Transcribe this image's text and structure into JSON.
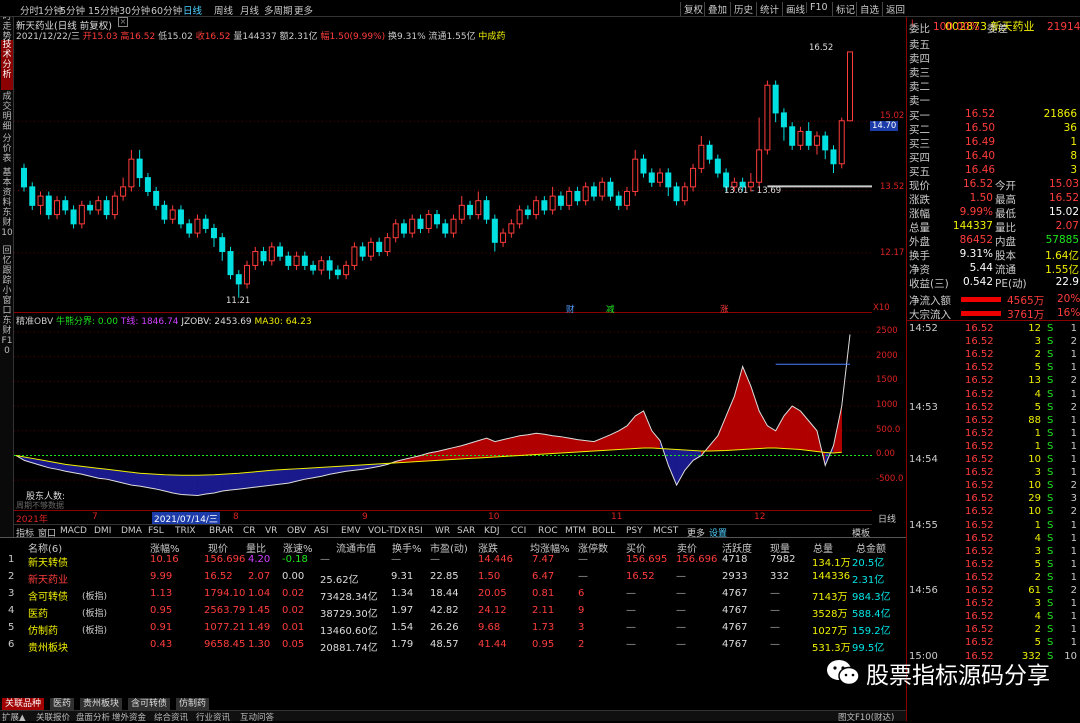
{
  "top": {
    "periods": [
      "分时",
      "1分钟",
      "5分钟",
      "15分钟",
      "30分钟",
      "60分钟",
      "日线",
      "周线",
      "月线",
      "多周期",
      "更多"
    ],
    "selected": "日线",
    "tools": [
      "复权",
      "叠加",
      "历史",
      "统计",
      "画线",
      "F10",
      "标记",
      "自选",
      "返回"
    ]
  },
  "left_sidebar": [
    "分时走势",
    "技术分析",
    "成交明细",
    "分价表",
    "基本资料",
    "东财10",
    "回忆跟踪",
    "小窗口",
    "东财F10"
  ],
  "main_chart": {
    "header_title": "新天药业(日线 前复权)",
    "info_date": "2021/12/22/三",
    "open": "开15.03",
    "high": "高16.52",
    "low": "低15.02",
    "close": "收16.52",
    "volume": "量144337",
    "amount": "额2.31亿",
    "change": "幅1.50(9.99%)",
    "turnover": "换9.31%",
    "float_value": "流通1.55亿",
    "concept": "中成药",
    "price_axis": [
      "15.02",
      "14.70",
      "13.52",
      "12.17"
    ],
    "label_max": "16.52",
    "label_min": "11.21",
    "label_range": "13.61 - 13.69",
    "markers": [
      "财",
      "减",
      "涨"
    ],
    "zoom": "X10"
  },
  "obv_chart": {
    "title": "精准OBV",
    "label1": "牛熊分界: 0.00",
    "label2": "T线: 1846.74",
    "label3": "JZOBV: 2453.69",
    "label4": "MA30: 64.23",
    "axis": [
      "2500",
      "2000",
      "1500",
      "1000",
      "500.0",
      "0.00",
      "-500.0"
    ],
    "footer_label": "股东人数:",
    "footer_sub": "周期不够数据",
    "date_axis": [
      "2021年",
      "7",
      "2021/07/14/三",
      "8",
      "9",
      "10",
      "11",
      "12"
    ],
    "period": "日线"
  },
  "indicator_tabs": [
    "指标",
    "窗口",
    "MACD",
    "DMI",
    "DMA",
    "FSL",
    "TRIX",
    "BRAR",
    "CR",
    "VR",
    "OBV",
    "ASI",
    "EMV",
    "VOL-TDX",
    "RSI",
    "WR",
    "SAR",
    "KDJ",
    "CCI",
    "ROC",
    "MTM",
    "BOLL",
    "PSY",
    "MCST",
    "更多",
    "设置"
  ],
  "table": {
    "headers": [
      "名称(6)",
      "涨幅%",
      "现价",
      "量比",
      "涨速%",
      "流通市值",
      "换手%",
      "市盈(动)",
      "涨跌",
      "均涨幅%",
      "涨停数",
      "买价",
      "卖价",
      "活跃度",
      "现量",
      "总量",
      "总金额"
    ],
    "rows": [
      {
        "no": "1",
        "name": "新天转债",
        "tag": "",
        "c": [
          "10.16",
          "156.696",
          "4.20",
          "-0.18",
          "—",
          "—",
          "—",
          "14.446",
          "7.47",
          "—",
          "156.695",
          "156.696",
          "4718",
          "7982",
          "134.1万",
          "20.5亿"
        ]
      },
      {
        "no": "2",
        "name": "新天药业",
        "tag": "",
        "c": [
          "9.99",
          "16.52",
          "2.07",
          "0.00",
          "25.62亿",
          "9.31",
          "22.85",
          "1.50",
          "6.47",
          "—",
          "16.52",
          "—",
          "2933",
          "332",
          "144336",
          "2.31亿"
        ]
      },
      {
        "no": "3",
        "name": "含可转债",
        "tag": "(板指)",
        "c": [
          "1.13",
          "1794.10",
          "1.04",
          "0.02",
          "73428.34亿",
          "1.34",
          "18.44",
          "20.05",
          "0.81",
          "6",
          "—",
          "—",
          "4767",
          "—",
          "7143万",
          "984.3亿"
        ]
      },
      {
        "no": "4",
        "name": "医药",
        "tag": "(板指)",
        "c": [
          "0.95",
          "2563.79",
          "1.45",
          "0.02",
          "38729.30亿",
          "1.97",
          "42.82",
          "24.12",
          "2.11",
          "9",
          "—",
          "—",
          "4767",
          "—",
          "3528万",
          "588.4亿"
        ]
      },
      {
        "no": "5",
        "name": "仿制药",
        "tag": "(板指)",
        "c": [
          "0.91",
          "1077.21",
          "1.49",
          "0.01",
          "13460.60亿",
          "1.54",
          "26.26",
          "9.68",
          "1.73",
          "3",
          "—",
          "—",
          "4767",
          "—",
          "1027万",
          "159.2亿"
        ]
      },
      {
        "no": "6",
        "name": "贵州板块",
        "tag": "",
        "c": [
          "0.43",
          "9658.45",
          "1.30",
          "0.05",
          "20881.74亿",
          "1.79",
          "48.57",
          "41.44",
          "0.95",
          "2",
          "—",
          "—",
          "4767",
          "—",
          "531.3万",
          "99.5亿"
        ]
      }
    ]
  },
  "bottom_tabs": [
    "关联品种",
    "医药",
    "贵州板块",
    "含可转债",
    "仿制药"
  ],
  "status_bar": [
    "扩展▲",
    "关联报价",
    "盘面分析",
    "增外资金",
    "综合资讯",
    "行业资讯",
    "互动问答",
    "图文F10(财达)"
  ],
  "right_panel": {
    "code_line": "002873 新天药业",
    "wb_label": "委比",
    "wb": "100.00%",
    "wc_label": "委差",
    "wc": "21914",
    "asks": [
      "卖五",
      "卖四",
      "卖三",
      "卖二",
      "卖一"
    ],
    "bids": [
      [
        "买一",
        "16.52",
        "21866"
      ],
      [
        "买二",
        "16.50",
        "36"
      ],
      [
        "买三",
        "16.49",
        "1"
      ],
      [
        "买四",
        "16.40",
        "8"
      ],
      [
        "买五",
        "16.46",
        "3"
      ]
    ],
    "stats": [
      [
        "现价",
        "16.52",
        "今开",
        "15.03"
      ],
      [
        "涨跌",
        "1.50",
        "最高",
        "16.52"
      ],
      [
        "涨幅",
        "9.99%",
        "最低",
        "15.02"
      ],
      [
        "总量",
        "144337",
        "量比",
        "2.07"
      ],
      [
        "外盘",
        "86452",
        "内盘",
        "57885"
      ],
      [
        "换手",
        "9.31%",
        "股本",
        "1.64亿"
      ],
      [
        "净资",
        "5.44",
        "流通",
        "1.55亿"
      ],
      [
        "收益(三)",
        "0.542",
        "PE(动)",
        "22.9"
      ]
    ],
    "flow": [
      [
        "净流入额",
        "4565万",
        "20%"
      ],
      [
        "大宗流入",
        "3761万",
        "16%"
      ]
    ],
    "ticks": [
      [
        "14:52",
        "16.52",
        "12",
        "S",
        "1"
      ],
      [
        "",
        "16.52",
        "3",
        "S",
        "2"
      ],
      [
        "",
        "16.52",
        "2",
        "S",
        "1"
      ],
      [
        "",
        "16.52",
        "5",
        "S",
        "1"
      ],
      [
        "",
        "16.52",
        "13",
        "S",
        "2"
      ],
      [
        "",
        "16.52",
        "4",
        "S",
        "1"
      ],
      [
        "14:53",
        "16.52",
        "5",
        "S",
        "2"
      ],
      [
        "",
        "16.52",
        "88",
        "S",
        "1"
      ],
      [
        "",
        "16.52",
        "1",
        "S",
        "1"
      ],
      [
        "",
        "16.52",
        "1",
        "S",
        "1"
      ],
      [
        "14:54",
        "16.52",
        "10",
        "S",
        "1"
      ],
      [
        "",
        "16.52",
        "3",
        "S",
        "1"
      ],
      [
        "",
        "16.52",
        "10",
        "S",
        "2"
      ],
      [
        "",
        "16.52",
        "29",
        "S",
        "3"
      ],
      [
        "",
        "16.52",
        "10",
        "S",
        "2"
      ],
      [
        "14:55",
        "16.52",
        "1",
        "S",
        "1"
      ],
      [
        "",
        "16.52",
        "4",
        "S",
        "1"
      ],
      [
        "",
        "16.52",
        "3",
        "S",
        "1"
      ],
      [
        "",
        "16.52",
        "5",
        "S",
        "1"
      ],
      [
        "",
        "16.52",
        "2",
        "S",
        "1"
      ],
      [
        "14:56",
        "16.52",
        "61",
        "S",
        "2"
      ],
      [
        "",
        "16.52",
        "3",
        "S",
        "1"
      ],
      [
        "",
        "16.52",
        "4",
        "S",
        "1"
      ],
      [
        "",
        "16.52",
        "2",
        "S",
        "1"
      ],
      [
        "",
        "16.52",
        "5",
        "S",
        "1"
      ],
      [
        "15:00",
        "16.52",
        "332",
        "S",
        "10"
      ]
    ]
  },
  "watermark": "股票指标源码分享",
  "candles": [
    [
      14.0,
      13.6,
      14.1,
      13.5
    ],
    [
      13.6,
      13.2,
      13.7,
      13.1
    ],
    [
      13.2,
      13.4,
      13.5,
      13.0
    ],
    [
      13.4,
      13.0,
      13.5,
      12.9
    ],
    [
      13.0,
      13.3,
      13.4,
      12.9
    ],
    [
      13.3,
      13.1,
      13.4,
      13.0
    ],
    [
      13.1,
      12.8,
      13.2,
      12.7
    ],
    [
      12.8,
      13.2,
      13.3,
      12.7
    ],
    [
      13.2,
      13.1,
      13.3,
      13.0
    ],
    [
      13.1,
      13.3,
      13.4,
      13.0
    ],
    [
      13.3,
      13.0,
      13.4,
      12.9
    ],
    [
      13.0,
      13.4,
      13.5,
      12.9
    ],
    [
      13.4,
      13.6,
      13.8,
      13.3
    ],
    [
      13.6,
      14.2,
      14.4,
      13.5
    ],
    [
      14.2,
      13.8,
      14.4,
      13.6
    ],
    [
      13.8,
      13.5,
      13.9,
      13.4
    ],
    [
      13.5,
      13.2,
      13.6,
      13.1
    ],
    [
      13.2,
      12.9,
      13.3,
      12.8
    ],
    [
      12.9,
      13.1,
      13.2,
      12.8
    ],
    [
      13.1,
      12.8,
      13.2,
      12.7
    ],
    [
      12.8,
      12.6,
      12.9,
      12.5
    ],
    [
      12.6,
      12.9,
      13.0,
      12.5
    ],
    [
      12.9,
      12.7,
      13.0,
      12.6
    ],
    [
      12.7,
      12.5,
      12.8,
      12.3
    ],
    [
      12.5,
      12.2,
      12.6,
      12.0
    ],
    [
      12.2,
      11.7,
      12.3,
      11.6
    ],
    [
      11.7,
      11.5,
      11.8,
      11.2
    ],
    [
      11.5,
      11.9,
      12.0,
      11.4
    ],
    [
      11.9,
      12.2,
      12.3,
      11.8
    ],
    [
      12.2,
      12.0,
      12.3,
      11.9
    ],
    [
      12.0,
      12.3,
      12.4,
      11.9
    ],
    [
      12.3,
      12.1,
      12.4,
      12.0
    ],
    [
      12.1,
      11.9,
      12.2,
      11.8
    ],
    [
      11.9,
      12.1,
      12.2,
      11.8
    ],
    [
      12.1,
      11.9,
      12.2,
      11.8
    ],
    [
      11.9,
      11.8,
      12.0,
      11.7
    ],
    [
      11.8,
      12.0,
      12.1,
      11.7
    ],
    [
      12.0,
      11.8,
      12.1,
      11.6
    ],
    [
      11.8,
      11.7,
      11.9,
      11.6
    ],
    [
      11.7,
      11.9,
      12.0,
      11.6
    ],
    [
      11.9,
      12.3,
      12.4,
      11.8
    ],
    [
      12.3,
      12.1,
      12.4,
      12.0
    ],
    [
      12.1,
      12.4,
      12.5,
      12.0
    ],
    [
      12.4,
      12.2,
      12.5,
      12.1
    ],
    [
      12.2,
      12.5,
      12.6,
      12.1
    ],
    [
      12.5,
      12.8,
      12.9,
      12.4
    ],
    [
      12.8,
      12.6,
      12.9,
      12.5
    ],
    [
      12.6,
      12.9,
      13.0,
      12.5
    ],
    [
      12.9,
      12.7,
      13.0,
      12.6
    ],
    [
      12.7,
      13.0,
      13.1,
      12.6
    ],
    [
      13.0,
      12.8,
      13.1,
      12.7
    ],
    [
      12.8,
      12.6,
      12.9,
      12.5
    ],
    [
      12.6,
      12.9,
      13.0,
      12.5
    ],
    [
      12.9,
      13.2,
      13.4,
      12.8
    ],
    [
      13.2,
      13.0,
      13.3,
      12.9
    ],
    [
      13.0,
      13.3,
      13.5,
      12.9
    ],
    [
      13.3,
      12.9,
      13.4,
      12.8
    ],
    [
      12.9,
      12.4,
      13.0,
      12.2
    ],
    [
      12.4,
      12.6,
      12.7,
      12.3
    ],
    [
      12.6,
      12.8,
      12.9,
      12.5
    ],
    [
      12.8,
      13.1,
      13.2,
      12.7
    ],
    [
      13.1,
      13.0,
      13.2,
      12.9
    ],
    [
      13.0,
      13.3,
      13.4,
      12.9
    ],
    [
      13.3,
      13.1,
      13.4,
      13.0
    ],
    [
      13.1,
      13.4,
      13.6,
      13.0
    ],
    [
      13.4,
      13.2,
      13.5,
      13.1
    ],
    [
      13.2,
      13.5,
      13.6,
      13.1
    ],
    [
      13.5,
      13.3,
      13.6,
      13.2
    ],
    [
      13.3,
      13.6,
      13.7,
      13.2
    ],
    [
      13.6,
      13.4,
      13.7,
      13.3
    ],
    [
      13.4,
      13.7,
      13.8,
      13.3
    ],
    [
      13.7,
      13.4,
      13.8,
      13.3
    ],
    [
      13.4,
      13.2,
      13.5,
      13.1
    ],
    [
      13.2,
      13.5,
      13.6,
      13.1
    ],
    [
      13.5,
      14.2,
      14.4,
      13.4
    ],
    [
      14.2,
      13.9,
      14.3,
      13.8
    ],
    [
      13.9,
      13.7,
      14.0,
      13.6
    ],
    [
      13.7,
      13.9,
      14.0,
      13.6
    ],
    [
      13.9,
      13.6,
      14.0,
      13.4
    ],
    [
      13.6,
      13.3,
      13.7,
      13.2
    ],
    [
      13.3,
      13.6,
      13.7,
      13.2
    ],
    [
      13.6,
      14.0,
      14.1,
      13.5
    ],
    [
      14.0,
      14.5,
      14.7,
      13.9
    ],
    [
      14.5,
      14.2,
      14.6,
      14.1
    ],
    [
      14.2,
      13.9,
      14.3,
      13.8
    ],
    [
      13.9,
      13.6,
      14.0,
      13.5
    ],
    [
      13.6,
      13.7,
      13.8,
      13.5
    ],
    [
      13.7,
      13.6,
      13.8,
      13.5
    ],
    [
      13.6,
      13.7,
      13.9,
      13.5
    ],
    [
      13.7,
      14.4,
      15.1,
      13.6
    ],
    [
      14.4,
      15.8,
      15.9,
      14.3
    ],
    [
      15.8,
      15.2,
      15.9,
      15.0
    ],
    [
      15.2,
      14.9,
      15.3,
      14.6
    ],
    [
      14.9,
      14.5,
      15.0,
      14.4
    ],
    [
      14.5,
      14.8,
      14.9,
      14.4
    ],
    [
      14.8,
      14.5,
      15.0,
      14.4
    ],
    [
      14.5,
      14.7,
      14.8,
      14.3
    ],
    [
      14.7,
      14.4,
      14.8,
      14.2
    ],
    [
      14.4,
      14.1,
      14.5,
      13.9
    ],
    [
      14.1,
      15.03,
      15.1,
      14.0
    ],
    [
      15.03,
      16.52,
      16.52,
      15.02
    ]
  ],
  "obv": [
    0,
    -100,
    -150,
    -200,
    -250,
    -280,
    -320,
    -350,
    -380,
    -420,
    -460,
    -480,
    -520,
    -560,
    -600,
    -620,
    -650,
    -680,
    -720,
    -760,
    -790,
    -800,
    -810,
    -780,
    -760,
    -720,
    -700,
    -680,
    -660,
    -640,
    -620,
    -600,
    -580,
    -560,
    -520,
    -480,
    -450,
    -420,
    -380,
    -350,
    -320,
    -300,
    -280,
    -250,
    -220,
    -180,
    -120,
    -80,
    -40,
    0,
    50,
    80,
    120,
    160,
    200,
    250,
    300,
    350,
    280,
    320,
    360,
    400,
    420,
    450,
    430,
    400,
    380,
    350,
    320,
    300,
    280,
    350,
    420,
    500,
    600,
    800,
    900,
    500,
    300,
    -200,
    -600,
    -300,
    -100,
    0,
    200,
    400,
    800,
    1200,
    1800,
    1400,
    900,
    600,
    500,
    800,
    1000,
    900,
    700,
    500,
    -200,
    200,
    1000,
    2450
  ],
  "ma": [
    0,
    -30,
    -60,
    -90,
    -120,
    -150,
    -180,
    -200,
    -220,
    -240,
    -260,
    -280,
    -300,
    -320,
    -340,
    -360,
    -370,
    -380,
    -390,
    -395,
    -400,
    -400,
    -400,
    -395,
    -390,
    -380,
    -370,
    -360,
    -345,
    -330,
    -315,
    -300,
    -290,
    -280,
    -270,
    -260,
    -250,
    -240,
    -230,
    -220,
    -210,
    -200,
    -190,
    -180,
    -170,
    -160,
    -150,
    -140,
    -130,
    -120,
    -110,
    -100,
    -90,
    -80,
    -70,
    -60,
    -50,
    -40,
    -30,
    -20,
    -10,
    0,
    10,
    20,
    30,
    40,
    50,
    60,
    70,
    80,
    90,
    100,
    110,
    120,
    130,
    140,
    150,
    150,
    140,
    130,
    120,
    110,
    100,
    90,
    90,
    95,
    100,
    110,
    120,
    130,
    140,
    150,
    150,
    140,
    130,
    120,
    100,
    80,
    60,
    50,
    64
  ]
}
